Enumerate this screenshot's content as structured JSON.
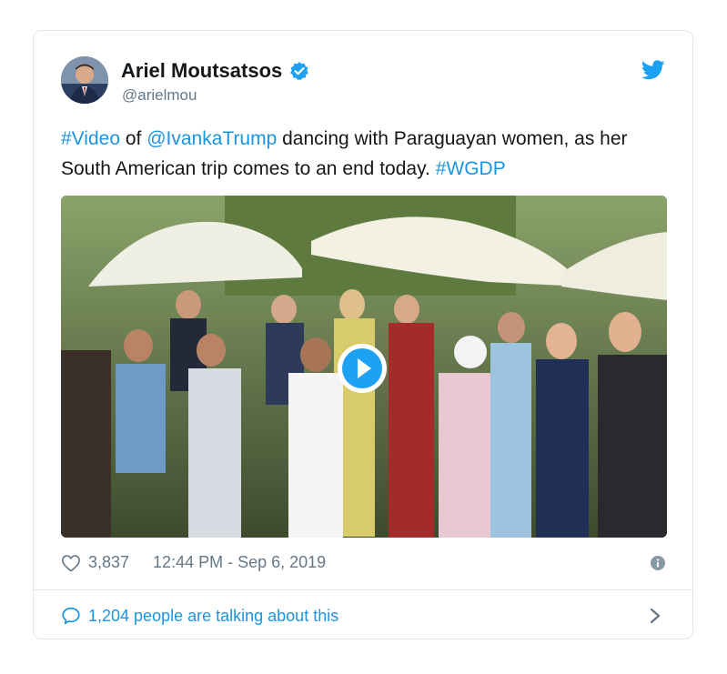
{
  "tweet": {
    "author_name": "Ariel Moutsatsos",
    "author_handle": "@arielmou",
    "text_parts": {
      "hashtag1": "#Video",
      "of": " of ",
      "mention": "@IvankaTrump",
      "body": " dancing with Paraguayan women, as her South American trip comes to an end today. ",
      "hashtag2": "#WGDP"
    },
    "likes": "3,837",
    "timestamp": "12:44 PM - Sep 6, 2019",
    "talking": "1,204 people are talking about this"
  },
  "icons": {
    "verified": "verified-badge-icon",
    "twitter": "twitter-bird-icon",
    "heart": "heart-icon",
    "info": "info-icon",
    "comment": "speech-bubble-icon",
    "chevron": "chevron-right-icon",
    "play": "play-icon"
  },
  "colors": {
    "link": "#1b95e0",
    "muted": "#657786",
    "text": "#14171a",
    "border": "#e1e8ed"
  }
}
